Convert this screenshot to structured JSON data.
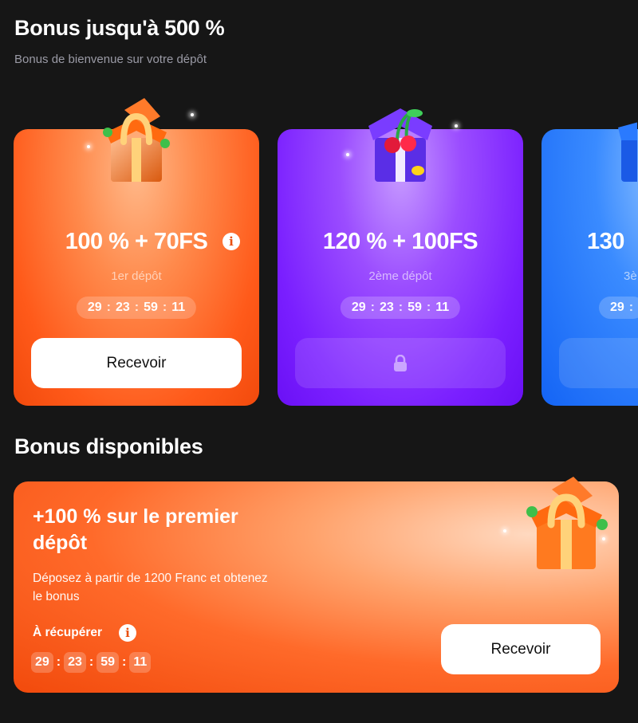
{
  "welcome": {
    "title": "Bonus jusqu'à 500 %",
    "subtitle": "Bonus de bienvenue sur votre dépôt"
  },
  "cards": [
    {
      "bonus": "100 % + 70FS",
      "deposit": "1er dépôt",
      "timer": [
        "29",
        "23",
        "59",
        "11"
      ],
      "button_label": "Recevoir",
      "locked": false,
      "color": "#ff5a1a"
    },
    {
      "bonus": "120 % + 100FS",
      "deposit": "2ème dépôt",
      "timer": [
        "29",
        "23",
        "59",
        "11"
      ],
      "button_label": "",
      "locked": true,
      "color": "#7a1fff"
    },
    {
      "bonus": "130",
      "deposit": "3è",
      "timer": [
        "29"
      ],
      "button_label": "",
      "locked": true,
      "color": "#1464f5"
    }
  ],
  "available": {
    "title": "Bonus disponibles",
    "offer_title": "+100 % sur le premier dépôt",
    "description": "Déposez à partir de 1200 Franc et obtenez le bonus",
    "claim_label": "À récupérer",
    "timer": [
      "29",
      "23",
      "59",
      "11"
    ],
    "button_label": "Recevoir",
    "color": "#f24a0c"
  },
  "icons": {
    "info": "info-icon",
    "lock": "lock-icon",
    "gift": "gift-icon"
  }
}
